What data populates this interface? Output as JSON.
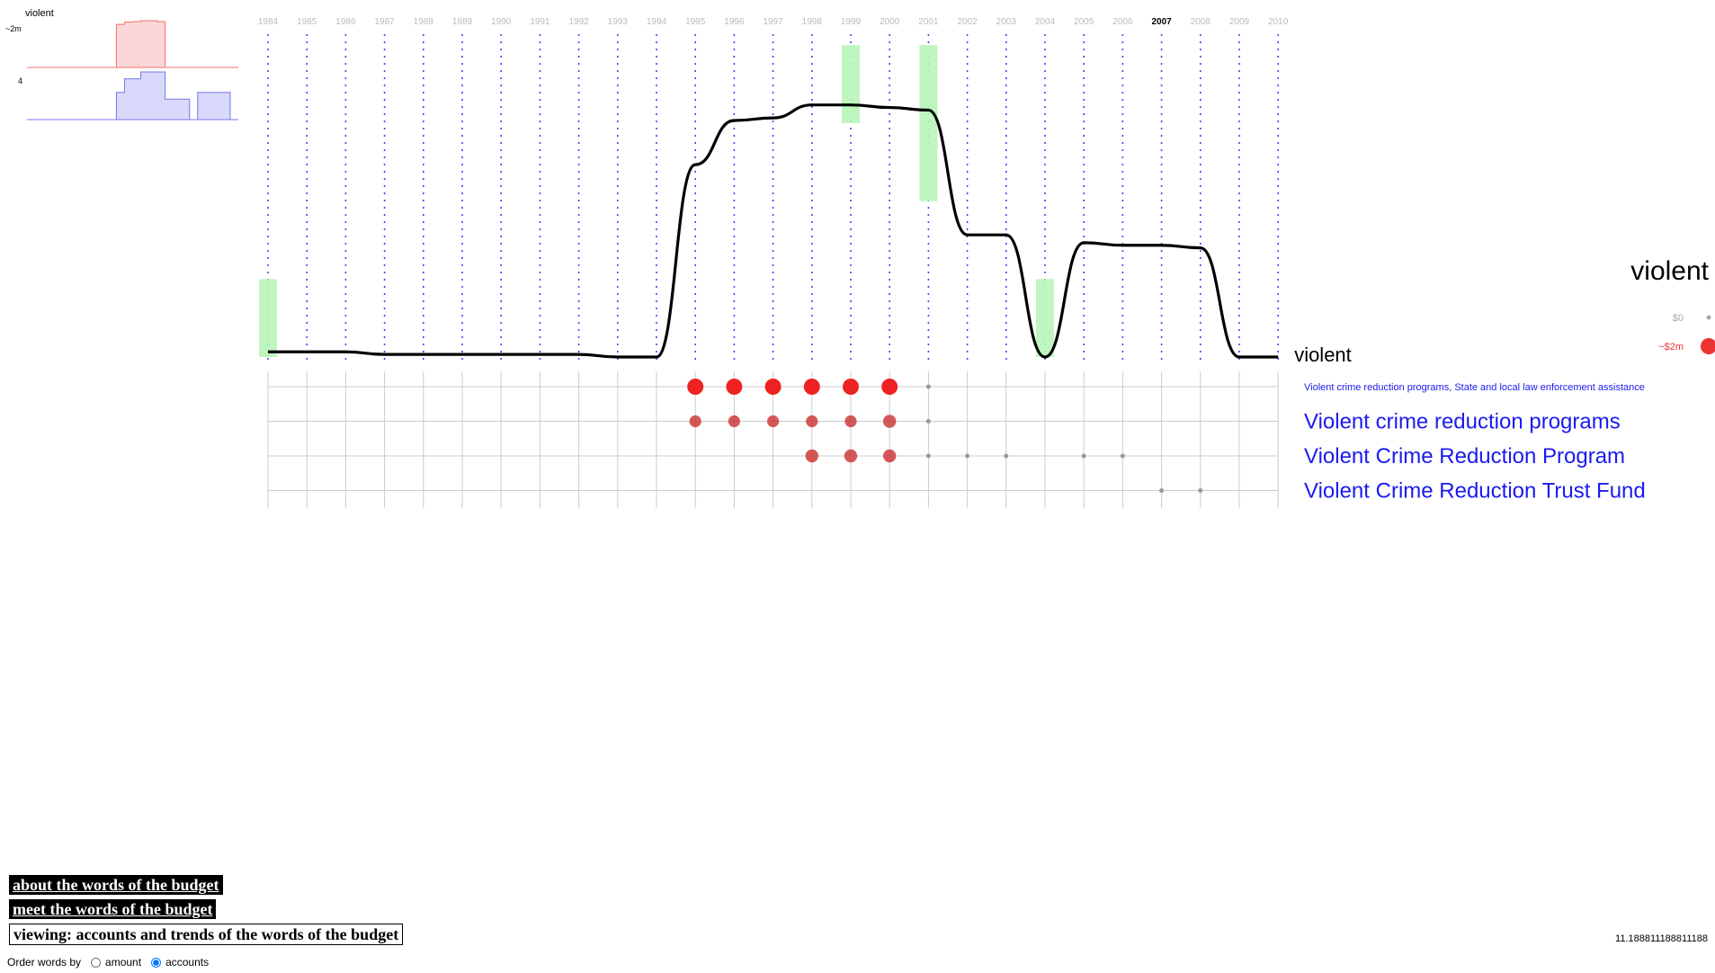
{
  "chart_data": {
    "type": "line",
    "word": "violent",
    "years": [
      "1984",
      "1985",
      "1986",
      "1987",
      "1988",
      "1989",
      "1990",
      "1991",
      "1992",
      "1993",
      "1994",
      "1995",
      "1996",
      "1997",
      "1998",
      "1999",
      "2000",
      "2001",
      "2002",
      "2003",
      "2004",
      "2005",
      "2006",
      "2007",
      "2008",
      "2009",
      "2010"
    ],
    "highlight_year": "2007",
    "trend_values": [
      0.02,
      0.02,
      0.02,
      0.01,
      0.01,
      0.01,
      0.01,
      0.01,
      0.01,
      0.0,
      0.0,
      0.74,
      0.91,
      0.92,
      0.97,
      0.97,
      0.96,
      0.95,
      0.47,
      0.47,
      0.0,
      0.44,
      0.43,
      0.43,
      0.42,
      0.0,
      0.0
    ],
    "spikes": [
      {
        "year": "1984",
        "from": 0.0,
        "to": 0.3
      },
      {
        "year": "1999",
        "from": 0.9,
        "to": 1.2
      },
      {
        "year": "2001",
        "from": 0.6,
        "to": 1.2
      },
      {
        "year": "2004",
        "from": 0.0,
        "to": 0.3
      }
    ],
    "legend": {
      "title": "violent",
      "items": [
        {
          "label": "$0",
          "color": "#aaaaaa",
          "size": "small"
        },
        {
          "label": "~$2m",
          "color": "#ee3333",
          "size": "large"
        }
      ]
    },
    "accounts": [
      {
        "label": "Violent crime reduction programs, State and local law enforcement assistance",
        "label_size": "small",
        "dots": [
          {
            "year": "1995",
            "level": 1.0
          },
          {
            "year": "1996",
            "level": 1.0
          },
          {
            "year": "1997",
            "level": 1.0
          },
          {
            "year": "1998",
            "level": 1.0
          },
          {
            "year": "1999",
            "level": 1.0
          },
          {
            "year": "2000",
            "level": 1.0
          },
          {
            "year": "2001",
            "level": 0.0
          }
        ]
      },
      {
        "label": "Violent crime reduction programs",
        "label_size": "large",
        "dots": [
          {
            "year": "1995",
            "level": 0.6
          },
          {
            "year": "1996",
            "level": 0.6
          },
          {
            "year": "1997",
            "level": 0.6
          },
          {
            "year": "1998",
            "level": 0.6
          },
          {
            "year": "1999",
            "level": 0.6
          },
          {
            "year": "2000",
            "level": 0.7
          },
          {
            "year": "2001",
            "level": 0.0
          }
        ]
      },
      {
        "label": "Violent Crime Reduction Program",
        "label_size": "large",
        "dots": [
          {
            "year": "1998",
            "level": 0.7
          },
          {
            "year": "1999",
            "level": 0.7
          },
          {
            "year": "2000",
            "level": 0.7
          },
          {
            "year": "2001",
            "level": 0.0
          },
          {
            "year": "2002",
            "level": 0.0
          },
          {
            "year": "2003",
            "level": 0.0
          },
          {
            "year": "2005",
            "level": 0.0
          },
          {
            "year": "2006",
            "level": 0.0
          }
        ]
      },
      {
        "label": "Violent Crime Reduction Trust Fund",
        "label_size": "large",
        "dots": [
          {
            "year": "2007",
            "level": 0.0
          },
          {
            "year": "2008",
            "level": 0.0
          }
        ]
      }
    ],
    "mini_charts": {
      "word": "violent",
      "amount_label": "~2m",
      "amount_color": "#f07070",
      "amount_values": [
        0,
        0,
        0,
        0,
        0,
        0,
        0,
        0,
        0,
        0,
        0,
        0.92,
        0.97,
        0.98,
        1.0,
        1.0,
        0.98,
        0,
        0,
        0,
        0,
        0,
        0,
        0,
        0,
        0,
        0
      ],
      "count_label": "4",
      "count_color": "#7777ee",
      "count_values": [
        0,
        0,
        0,
        0,
        0,
        0,
        0,
        0,
        0,
        0,
        0,
        2,
        3,
        3,
        3.5,
        3.5,
        3.5,
        1.5,
        1.5,
        1.5,
        0,
        2,
        2,
        2,
        2,
        0,
        0
      ]
    }
  },
  "trend_word_label": "violent",
  "nav": {
    "about": "about the words of the budget",
    "meet": "meet the words of the budget",
    "viewing": "viewing: accounts and trends of the words of the budget"
  },
  "order": {
    "label": "Order words by",
    "option_amount": "amount",
    "option_accounts": "accounts",
    "selected": "accounts"
  },
  "zoom_readout": "11.188811188811188"
}
